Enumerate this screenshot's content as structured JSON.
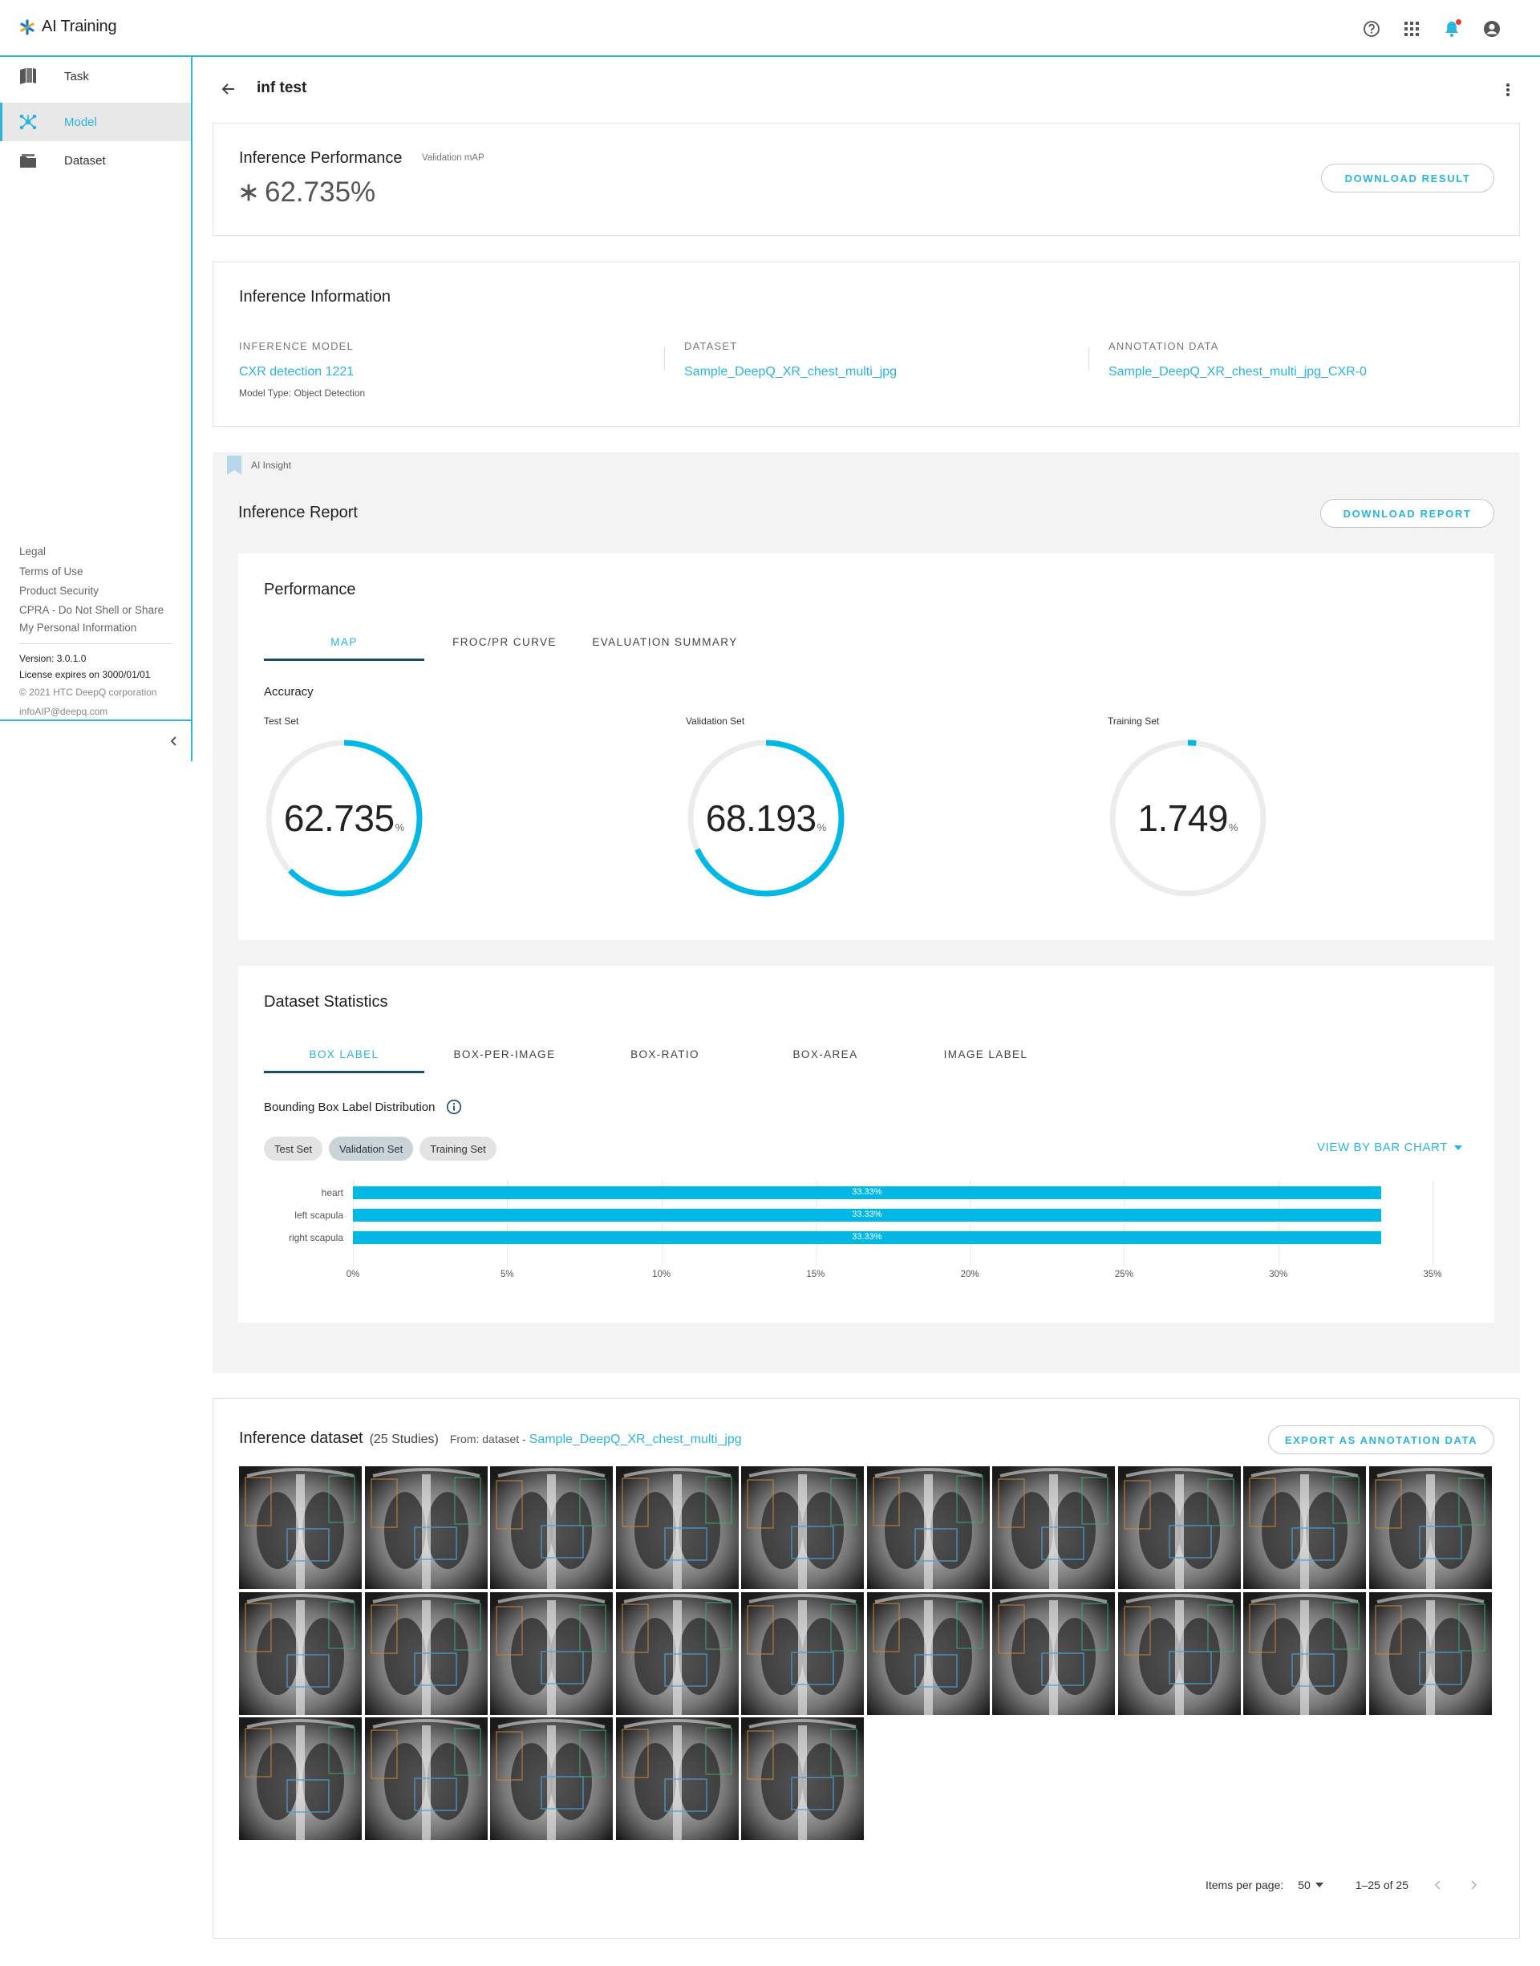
{
  "app": {
    "title": "AI Training"
  },
  "header": {
    "icons": [
      "help-icon",
      "apps-grid-icon",
      "notification-bell-icon",
      "account-icon"
    ]
  },
  "sidebar": {
    "items": [
      {
        "label": "Task",
        "icon": "book-icon"
      },
      {
        "label": "Model",
        "icon": "model-network-icon",
        "active": true
      },
      {
        "label": "Dataset",
        "icon": "dataset-folder-icon"
      }
    ],
    "footer_links": [
      "Legal",
      "Terms of Use",
      "Product Security",
      "CPRA - Do Not Shell or Share",
      "My Personal Information"
    ],
    "version": "Version: 3.0.1.0",
    "license": "License expires on 3000/01/01",
    "copyright": "© 2021 HTC DeepQ corporation",
    "email": "infoAIP@deepq.com"
  },
  "page": {
    "title": "inf test"
  },
  "performance": {
    "title": "Inference Performance",
    "subtitle": "Validation mAP",
    "value": "62.735%",
    "download_label": "DOWNLOAD RESULT"
  },
  "info": {
    "title": "Inference Information",
    "model_label": "INFERENCE MODEL",
    "model_value": "CXR detection 1221",
    "model_type": "Model Type: Object Detection",
    "dataset_label": "DATASET",
    "dataset_value": "Sample_DeepQ_XR_chest_multi_jpg",
    "annotation_label": "ANNOTATION DATA",
    "annotation_value": "Sample_DeepQ_XR_chest_multi_jpg_CXR-0"
  },
  "insight": {
    "tag": "AI Insight",
    "title": "Inference Report",
    "download_label": "DOWNLOAD REPORT"
  },
  "perf_section": {
    "title": "Performance",
    "tabs": [
      "MAP",
      "FROC/PR CURVE",
      "EVALUATION SUMMARY"
    ],
    "active_tab": 0,
    "accuracy_label": "Accuracy",
    "rings": [
      {
        "title": "Test Set",
        "value": "62.735",
        "unit": "%",
        "fraction": 0.62735
      },
      {
        "title": "Validation Set",
        "value": "68.193",
        "unit": "%",
        "fraction": 0.68193
      },
      {
        "title": "Training Set",
        "value": "1.749",
        "unit": "%",
        "fraction": 0.01749
      }
    ]
  },
  "stats_section": {
    "title": "Dataset Statistics",
    "tabs": [
      "BOX LABEL",
      "BOX-PER-IMAGE",
      "BOX-RATIO",
      "BOX-AREA",
      "IMAGE LABEL"
    ],
    "active_tab": 0,
    "chart_title": "Bounding Box Label Distribution",
    "chips": [
      "Test Set",
      "Validation Set",
      "Training Set"
    ],
    "selected_chip": 1,
    "view_by": "VIEW BY BAR CHART"
  },
  "chart_data": {
    "type": "bar",
    "orientation": "horizontal",
    "categories": [
      "heart",
      "left scapula",
      "right scapula"
    ],
    "values": [
      33.33,
      33.33,
      33.33
    ],
    "data_labels": [
      "33.33%",
      "33.33%",
      "33.33%"
    ],
    "xlim": [
      0,
      35
    ],
    "xticks": [
      "0%",
      "5%",
      "10%",
      "15%",
      "20%",
      "25%",
      "30%",
      "35%"
    ],
    "grid": true,
    "color": "#00b8e6"
  },
  "dataset_panel": {
    "title": "Inference dataset",
    "count": "(25 Studies)",
    "from": "From: dataset -",
    "from_link": "Sample_DeepQ_XR_chest_multi_jpg",
    "export_label": "EXPORT AS ANNOTATION DATA",
    "thumbnail_count": 25,
    "items_per_page_label": "Items per page:",
    "items_per_page": "50",
    "range": "1–25 of 25"
  },
  "colors": {
    "accent": "#29b5dc",
    "bar": "#00b8e6",
    "ring_bg": "#ececec",
    "tab_underline": "#1b4a6b"
  }
}
